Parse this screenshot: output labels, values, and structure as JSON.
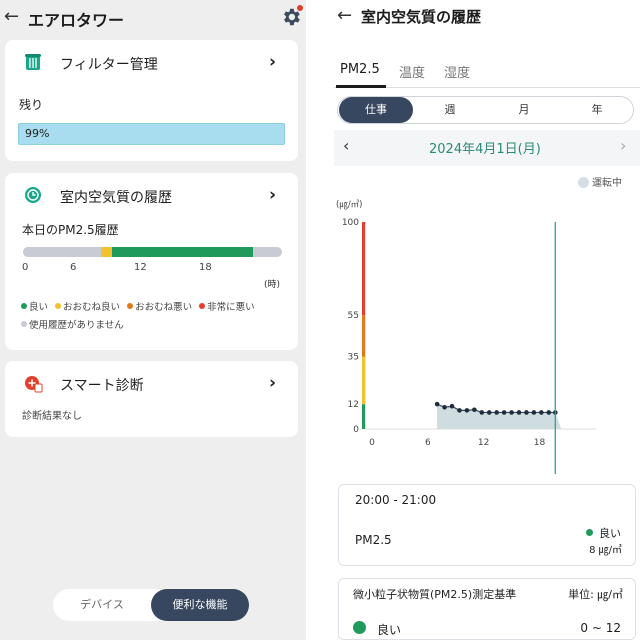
{
  "left": {
    "title": "エアロタワー",
    "filter_card": {
      "title": "フィルター管理",
      "remain_label": "残り",
      "remain_value": "99%",
      "remain_fraction": 0.99
    },
    "history_card": {
      "title": "室内空気質の履歴",
      "subtitle": "本日のPM2.5履歴",
      "ticks": [
        "0",
        "6",
        "12",
        "18"
      ],
      "unit": "(時)",
      "legend": [
        {
          "label": "良い",
          "color": "#1f9a5a"
        },
        {
          "label": "おおむね良い",
          "color": "#f2c12e"
        },
        {
          "label": "おおむね悪い",
          "color": "#e07a1c"
        },
        {
          "label": "非常に悪い",
          "color": "#e2402c"
        },
        {
          "label": "使用履歴がありません",
          "color": "#c9cbd4"
        }
      ]
    },
    "diag_card": {
      "title": "スマート診断",
      "subtitle": "診断結果なし"
    },
    "toggle": {
      "option1": "デバイス",
      "option2": "便利な機能"
    }
  },
  "right": {
    "title": "室内空気質の履歴",
    "tabs": [
      "PM2.5",
      "温度",
      "湿度"
    ],
    "periods": [
      "仕事",
      "週",
      "月",
      "年"
    ],
    "date": "2024年4月1日(月)",
    "running_label": "運転中",
    "chart_data": {
      "type": "line",
      "unit_label": "(㎍/㎥)",
      "y_ticks": [
        0,
        12,
        35,
        55,
        100
      ],
      "x_ticks": [
        0,
        6,
        12,
        18
      ],
      "xlim": [
        0,
        23
      ],
      "ylim": [
        0,
        100
      ],
      "bands": [
        {
          "from": 0,
          "to": 12,
          "color": "#1f9a5a"
        },
        {
          "from": 12,
          "to": 35,
          "color": "#f2c12e"
        },
        {
          "from": 35,
          "to": 55,
          "color": "#e07a1c"
        },
        {
          "from": 55,
          "to": 100,
          "color": "#e2402c"
        }
      ],
      "series": [
        {
          "x": [
            7,
            7.8,
            8.6,
            9.4,
            10.2,
            11,
            11.8,
            12.6,
            13.4,
            14.2,
            15,
            15.8,
            16.6,
            17.4,
            18.2,
            19,
            19.7
          ],
          "y": [
            12,
            10.5,
            11,
            9,
            9,
            9.3,
            8,
            8,
            8,
            8,
            8,
            8,
            8,
            8,
            8,
            8,
            8
          ]
        }
      ],
      "cursor_x": 19.7
    },
    "detail": {
      "time": "20:00 - 21:00",
      "name": "PM2.5",
      "status": "良い",
      "value": "8 ㎍/㎥"
    },
    "standard": {
      "title": "微小粒子状物質(PM2.5)測定基準",
      "unit": "単位: ㎍/㎥",
      "level_label": "良い",
      "level_range": "0 ~ 12"
    }
  }
}
